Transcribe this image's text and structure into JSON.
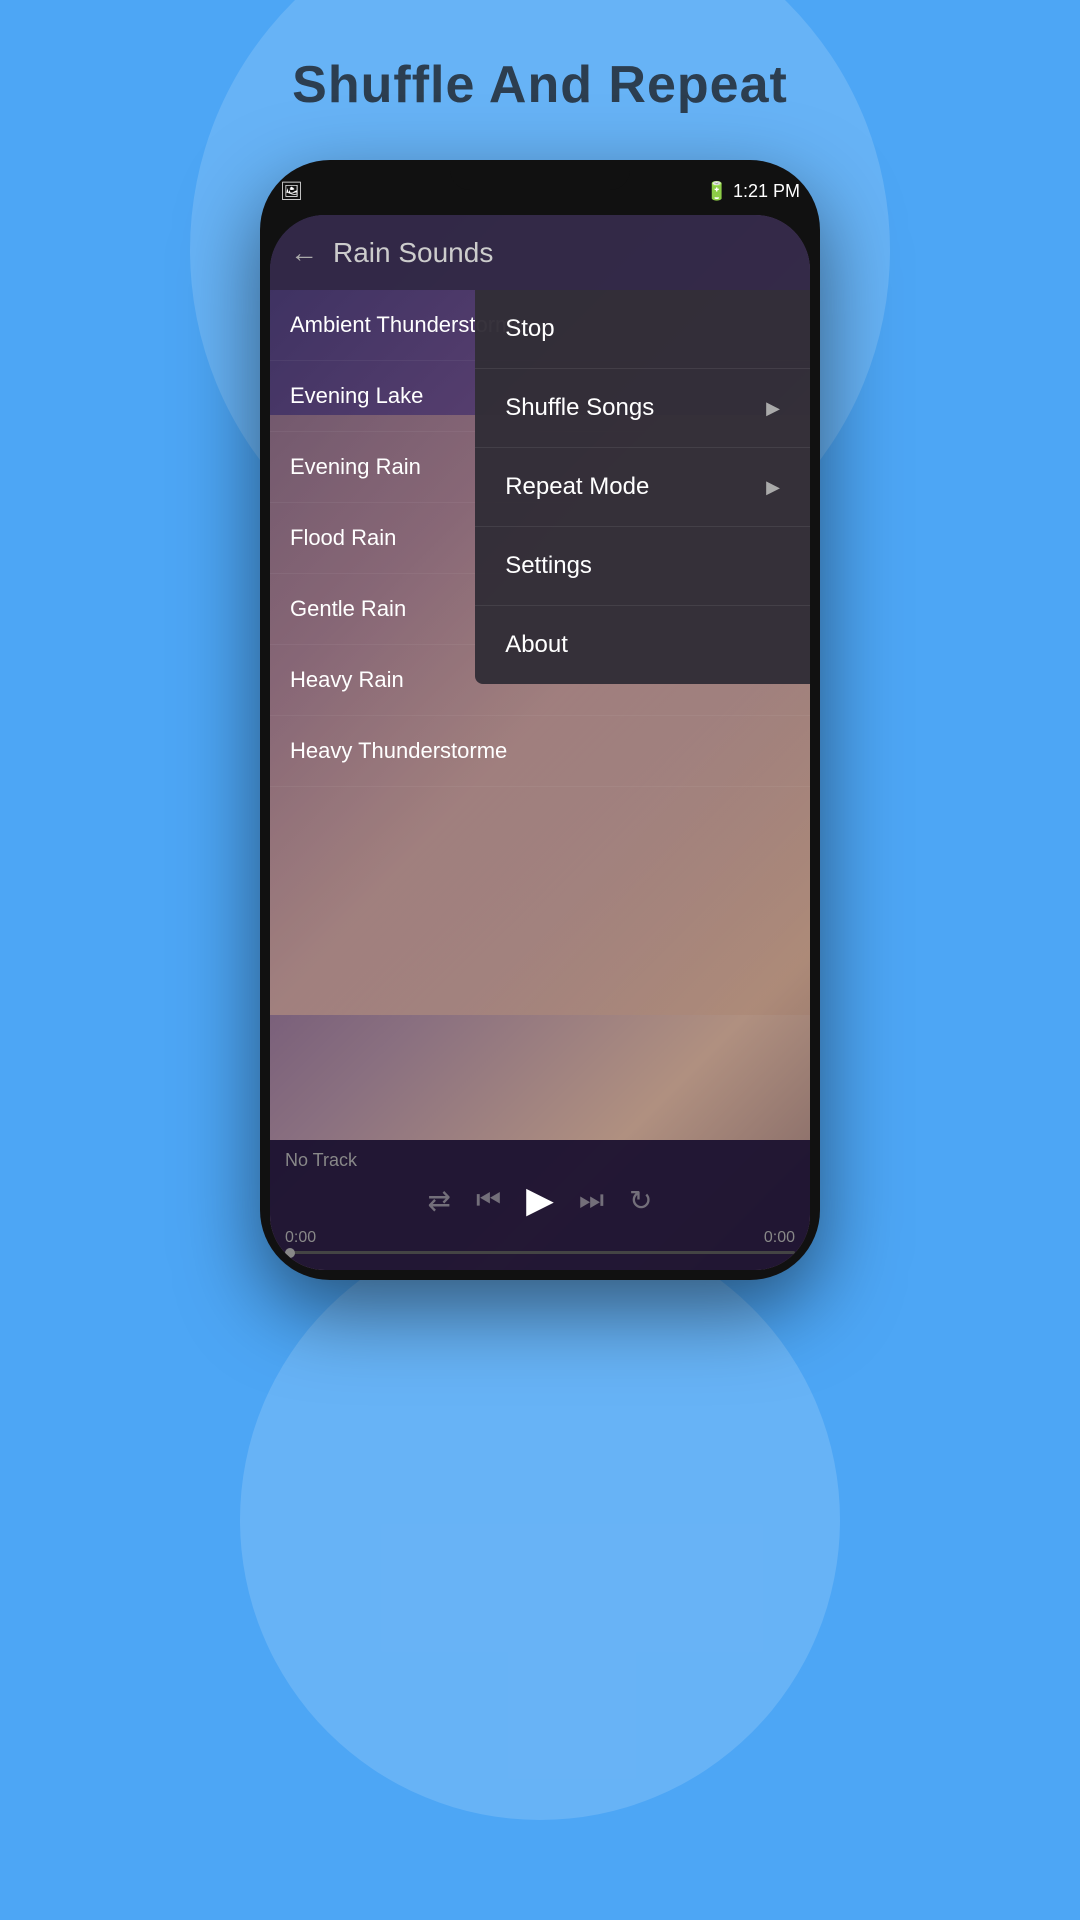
{
  "page": {
    "title": "Shuffle And Repeat",
    "background_color": "#4da6f5"
  },
  "status_bar": {
    "battery": "1:21 PM",
    "signal": "▐▌"
  },
  "app_header": {
    "title": "Rain Sounds",
    "back_icon": "←"
  },
  "menu": {
    "items": [
      {
        "label": "Stop",
        "has_arrow": false
      },
      {
        "label": "Shuffle Songs",
        "has_arrow": true
      },
      {
        "label": "Repeat Mode",
        "has_arrow": true
      },
      {
        "label": "Settings",
        "has_arrow": false
      },
      {
        "label": "About",
        "has_arrow": false
      }
    ]
  },
  "songs": [
    {
      "label": "Ambient Thunderstorme"
    },
    {
      "label": "Evening Lake"
    },
    {
      "label": "Evening Rain"
    },
    {
      "label": "Flood Rain"
    },
    {
      "label": "Gentle Rain"
    },
    {
      "label": "Heavy Rain"
    },
    {
      "label": "Heavy Thunderstorme"
    }
  ],
  "player": {
    "no_track": "No Track",
    "time_start": "0:00",
    "time_end": "0:00",
    "shuffle_icon": "⇄",
    "prev_icon": "⏮",
    "play_icon": "▶",
    "next_icon": "⏭",
    "repeat_icon": "↻"
  }
}
